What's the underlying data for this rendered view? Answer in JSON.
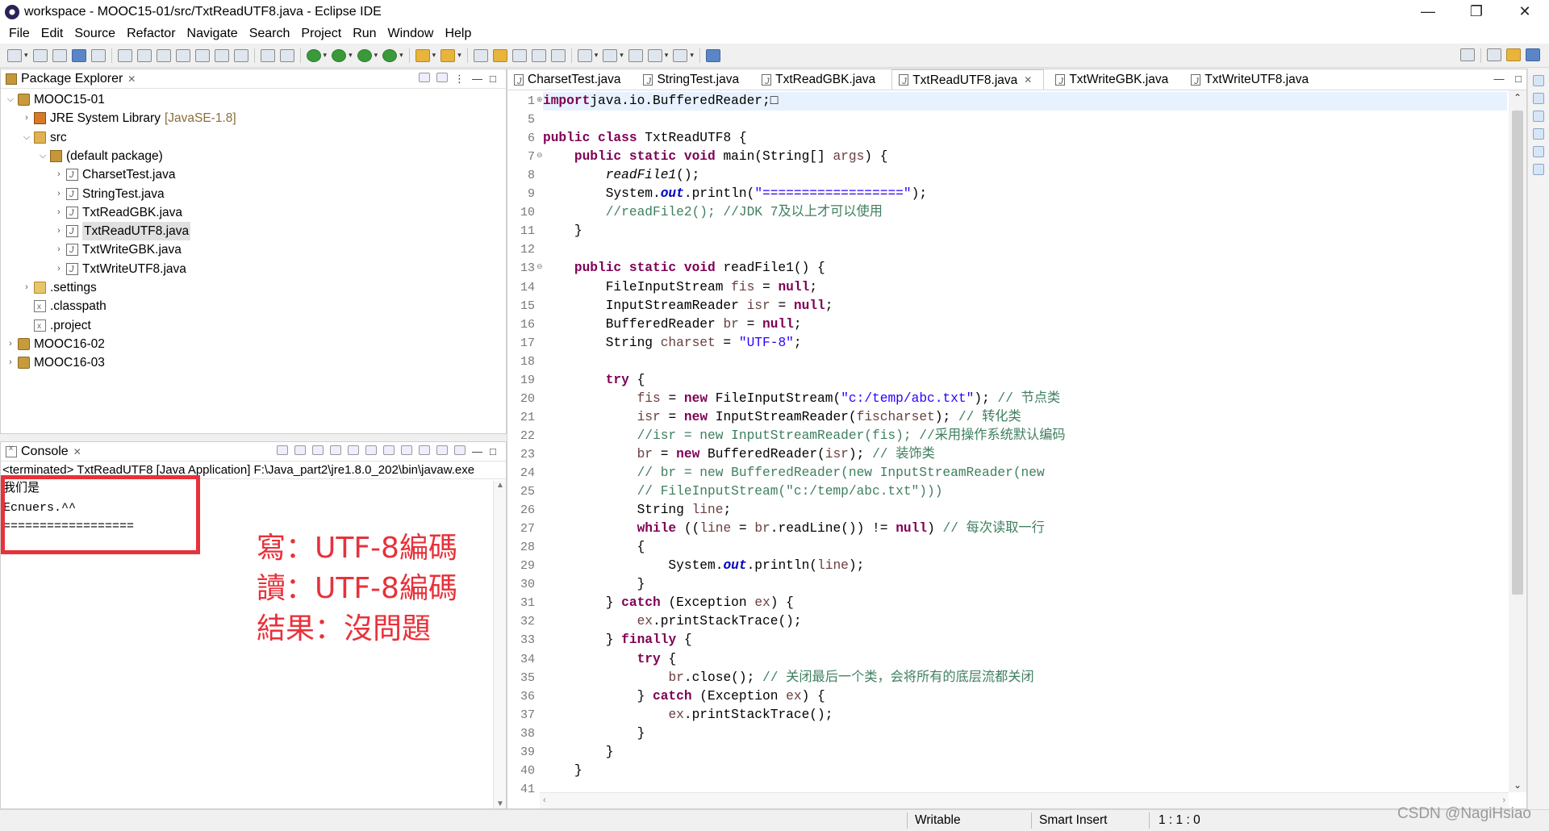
{
  "window": {
    "title": "workspace - MOOC15-01/src/TxtReadUTF8.java - Eclipse IDE",
    "controls": [
      "—",
      "❐",
      "✕"
    ]
  },
  "menu": [
    "File",
    "Edit",
    "Source",
    "Refactor",
    "Navigate",
    "Search",
    "Project",
    "Run",
    "Window",
    "Help"
  ],
  "package_explorer": {
    "title": "Package Explorer",
    "tree": [
      {
        "label": "MOOC15-01",
        "level": 0,
        "expanded": true,
        "icon": "project-icon"
      },
      {
        "label": "JRE System Library",
        "extra": "[JavaSE-1.8]",
        "level": 1,
        "expanded": false,
        "icon": "library-icon"
      },
      {
        "label": "src",
        "level": 1,
        "expanded": true,
        "icon": "source-folder-icon"
      },
      {
        "label": "(default package)",
        "level": 2,
        "expanded": true,
        "icon": "package-icon"
      },
      {
        "label": "CharsetTest.java",
        "level": 3,
        "expanded": false,
        "icon": "java-file-icon"
      },
      {
        "label": "StringTest.java",
        "level": 3,
        "expanded": false,
        "icon": "java-file-icon"
      },
      {
        "label": "TxtReadGBK.java",
        "level": 3,
        "expanded": false,
        "icon": "java-file-icon"
      },
      {
        "label": "TxtReadUTF8.java",
        "level": 3,
        "expanded": false,
        "icon": "java-file-icon",
        "selected": true
      },
      {
        "label": "TxtWriteGBK.java",
        "level": 3,
        "expanded": false,
        "icon": "java-file-icon"
      },
      {
        "label": "TxtWriteUTF8.java",
        "level": 3,
        "expanded": false,
        "icon": "java-file-icon"
      },
      {
        "label": ".settings",
        "level": 1,
        "expanded": false,
        "icon": "folder-icon"
      },
      {
        "label": ".classpath",
        "level": 1,
        "leaf": true,
        "icon": "file-icon"
      },
      {
        "label": ".project",
        "level": 1,
        "leaf": true,
        "icon": "file-icon"
      },
      {
        "label": "MOOC16-02",
        "level": 0,
        "expanded": false,
        "icon": "project-icon"
      },
      {
        "label": "MOOC16-03",
        "level": 0,
        "expanded": false,
        "icon": "project-icon"
      }
    ]
  },
  "console": {
    "title": "Console",
    "status": "<terminated> TxtReadUTF8 [Java Application] F:\\Java_part2\\jre1.8.0_202\\bin\\javaw.exe",
    "output": [
      "我们是",
      "Ecnuers.^^",
      "=================="
    ],
    "annotation": [
      "寫：UTF-8編碼",
      "讀：UTF-8編碼",
      "結果：沒問題"
    ]
  },
  "editor": {
    "tabs": [
      {
        "label": "CharsetTest.java",
        "active": false
      },
      {
        "label": "StringTest.java",
        "active": false
      },
      {
        "label": "TxtReadGBK.java",
        "active": false
      },
      {
        "label": "TxtReadUTF8.java",
        "active": true
      },
      {
        "label": "TxtWriteGBK.java",
        "active": false
      },
      {
        "label": "TxtWriteUTF8.java",
        "active": false
      }
    ],
    "lines": [
      {
        "n": "1",
        "fold": "⊕",
        "tokens": [
          [
            "kw",
            "import"
          ],
          [
            "",
            "java.io.BufferedReader;"
          ],
          [
            "",
            "□"
          ]
        ]
      },
      {
        "n": "5",
        "tokens": []
      },
      {
        "n": "6",
        "tokens": [
          [
            "kw",
            "public class "
          ],
          [
            "",
            "TxtReadUTF8 {"
          ]
        ]
      },
      {
        "n": "7",
        "fold": "⊖",
        "tokens": [
          [
            "",
            "    "
          ],
          [
            "kw",
            "public static void "
          ],
          [
            "",
            "main(String[] "
          ],
          [
            "var",
            "args"
          ],
          [
            "",
            ") {"
          ]
        ]
      },
      {
        "n": "8",
        "tokens": [
          [
            "",
            "        "
          ],
          [
            "ital",
            "readFile1"
          ],
          [
            "",
            "();"
          ]
        ]
      },
      {
        "n": "9",
        "tokens": [
          [
            "",
            "        System."
          ],
          [
            "fld",
            "out"
          ],
          [
            "",
            ".println("
          ],
          [
            "str",
            "\"==================\""
          ],
          [
            "",
            ");"
          ]
        ]
      },
      {
        "n": "10",
        "tokens": [
          [
            "cmt",
            "        //readFile2(); //JDK 7及以上才可以使用"
          ]
        ]
      },
      {
        "n": "11",
        "tokens": [
          [
            "",
            "    }"
          ]
        ]
      },
      {
        "n": "12",
        "tokens": []
      },
      {
        "n": "13",
        "fold": "⊖",
        "tokens": [
          [
            "",
            "    "
          ],
          [
            "kw",
            "public static void "
          ],
          [
            "",
            "readFile1() {"
          ]
        ]
      },
      {
        "n": "14",
        "tokens": [
          [
            "",
            "        FileInputStream "
          ],
          [
            "var",
            "fis"
          ],
          [
            "",
            " = "
          ],
          [
            "kw",
            "null"
          ],
          [
            "",
            ";"
          ]
        ]
      },
      {
        "n": "15",
        "tokens": [
          [
            "",
            "        InputStreamReader "
          ],
          [
            "var",
            "isr"
          ],
          [
            "",
            " = "
          ],
          [
            "kw",
            "null"
          ],
          [
            "",
            ";"
          ]
        ]
      },
      {
        "n": "16",
        "tokens": [
          [
            "",
            "        BufferedReader "
          ],
          [
            "var",
            "br"
          ],
          [
            "",
            " = "
          ],
          [
            "kw",
            "null"
          ],
          [
            "",
            ";"
          ]
        ]
      },
      {
        "n": "17",
        "tokens": [
          [
            "",
            "        String "
          ],
          [
            "var",
            "charset"
          ],
          [
            "",
            " = "
          ],
          [
            "str",
            "\"UTF-8\""
          ],
          [
            "",
            ";"
          ]
        ]
      },
      {
        "n": "18",
        "tokens": []
      },
      {
        "n": "19",
        "tokens": [
          [
            "",
            "        "
          ],
          [
            "kw",
            "try"
          ],
          [
            "",
            " {"
          ]
        ]
      },
      {
        "n": "20",
        "tokens": [
          [
            "",
            "            "
          ],
          [
            "var",
            "fis"
          ],
          [
            "",
            " = "
          ],
          [
            "kw",
            "new "
          ],
          [
            "",
            "FileInputStream("
          ],
          [
            "str",
            "\"c:/temp/abc.txt\""
          ],
          [
            "",
            "); "
          ],
          [
            "cmt",
            "// 节点类"
          ]
        ]
      },
      {
        "n": "21",
        "tokens": [
          [
            "",
            "            "
          ],
          [
            "var",
            "isr"
          ],
          [
            "",
            " = "
          ],
          [
            "kw",
            "new "
          ],
          [
            "",
            "InputStreamReader("
          ],
          [
            "var",
            "fis"
          ],
          [
            ", "
          ],
          [
            "var",
            "charset"
          ],
          [
            "",
            "); "
          ],
          [
            "cmt",
            "// 转化类"
          ]
        ]
      },
      {
        "n": "22",
        "tokens": [
          [
            "cmt",
            "            //isr = new InputStreamReader(fis); //采用操作系统默认编码"
          ]
        ]
      },
      {
        "n": "23",
        "tokens": [
          [
            "",
            "            "
          ],
          [
            "var",
            "br"
          ],
          [
            "",
            " = "
          ],
          [
            "kw",
            "new "
          ],
          [
            "",
            "BufferedReader("
          ],
          [
            "var",
            "isr"
          ],
          [
            "",
            "); "
          ],
          [
            "cmt",
            "// 装饰类"
          ]
        ]
      },
      {
        "n": "24",
        "tokens": [
          [
            "cmt",
            "            // br = new BufferedReader(new InputStreamReader(new"
          ]
        ]
      },
      {
        "n": "25",
        "tokens": [
          [
            "cmt",
            "            // FileInputStream(\"c:/temp/abc.txt\")))"
          ]
        ]
      },
      {
        "n": "26",
        "tokens": [
          [
            "",
            "            String "
          ],
          [
            "var",
            "line"
          ],
          [
            "",
            ";"
          ]
        ]
      },
      {
        "n": "27",
        "tokens": [
          [
            "",
            "            "
          ],
          [
            "kw",
            "while"
          ],
          [
            "",
            " (("
          ],
          [
            "var",
            "line"
          ],
          [
            "",
            " = "
          ],
          [
            "var",
            "br"
          ],
          [
            "",
            ".readLine()) != "
          ],
          [
            "kw",
            "null"
          ],
          [
            "",
            ") "
          ],
          [
            "cmt",
            "// 每次读取一行"
          ]
        ]
      },
      {
        "n": "28",
        "tokens": [
          [
            "",
            "            {"
          ]
        ]
      },
      {
        "n": "29",
        "tokens": [
          [
            "",
            "                System."
          ],
          [
            "fld",
            "out"
          ],
          [
            "",
            ".println("
          ],
          [
            "var",
            "line"
          ],
          [
            "",
            ");"
          ]
        ]
      },
      {
        "n": "30",
        "tokens": [
          [
            "",
            "            }"
          ]
        ]
      },
      {
        "n": "31",
        "tokens": [
          [
            "",
            "        } "
          ],
          [
            "kw",
            "catch"
          ],
          [
            "",
            " (Exception "
          ],
          [
            "var",
            "ex"
          ],
          [
            "",
            ") {"
          ]
        ]
      },
      {
        "n": "32",
        "tokens": [
          [
            "",
            "            "
          ],
          [
            "var",
            "ex"
          ],
          [
            "",
            ".printStackTrace();"
          ]
        ]
      },
      {
        "n": "33",
        "tokens": [
          [
            "",
            "        } "
          ],
          [
            "kw",
            "finally"
          ],
          [
            "",
            " {"
          ]
        ]
      },
      {
        "n": "34",
        "tokens": [
          [
            "",
            "            "
          ],
          [
            "kw",
            "try"
          ],
          [
            "",
            " {"
          ]
        ]
      },
      {
        "n": "35",
        "tokens": [
          [
            "",
            "                "
          ],
          [
            "var",
            "br"
          ],
          [
            "",
            ".close(); "
          ],
          [
            "cmt",
            "// 关闭最后一个类，会将所有的底层流都关闭"
          ]
        ]
      },
      {
        "n": "36",
        "tokens": [
          [
            "",
            "            } "
          ],
          [
            "kw",
            "catch"
          ],
          [
            "",
            " (Exception "
          ],
          [
            "var",
            "ex"
          ],
          [
            "",
            ") {"
          ]
        ]
      },
      {
        "n": "37",
        "tokens": [
          [
            "",
            "                "
          ],
          [
            "var",
            "ex"
          ],
          [
            "",
            ".printStackTrace();"
          ]
        ]
      },
      {
        "n": "38",
        "tokens": [
          [
            "",
            "            }"
          ]
        ]
      },
      {
        "n": "39",
        "tokens": [
          [
            "",
            "        }"
          ]
        ]
      },
      {
        "n": "40",
        "tokens": [
          [
            "",
            "    }"
          ]
        ]
      },
      {
        "n": "41",
        "tokens": []
      }
    ]
  },
  "statusbar": {
    "writable": "Writable",
    "insert_mode": "Smart Insert",
    "position": "1 : 1 : 0"
  },
  "watermark": "CSDN @NagiHsiao",
  "colors": {
    "keyword": "#7f0055",
    "string": "#2a00ff",
    "comment": "#3f7f5f",
    "annotation": "#e8313a"
  }
}
